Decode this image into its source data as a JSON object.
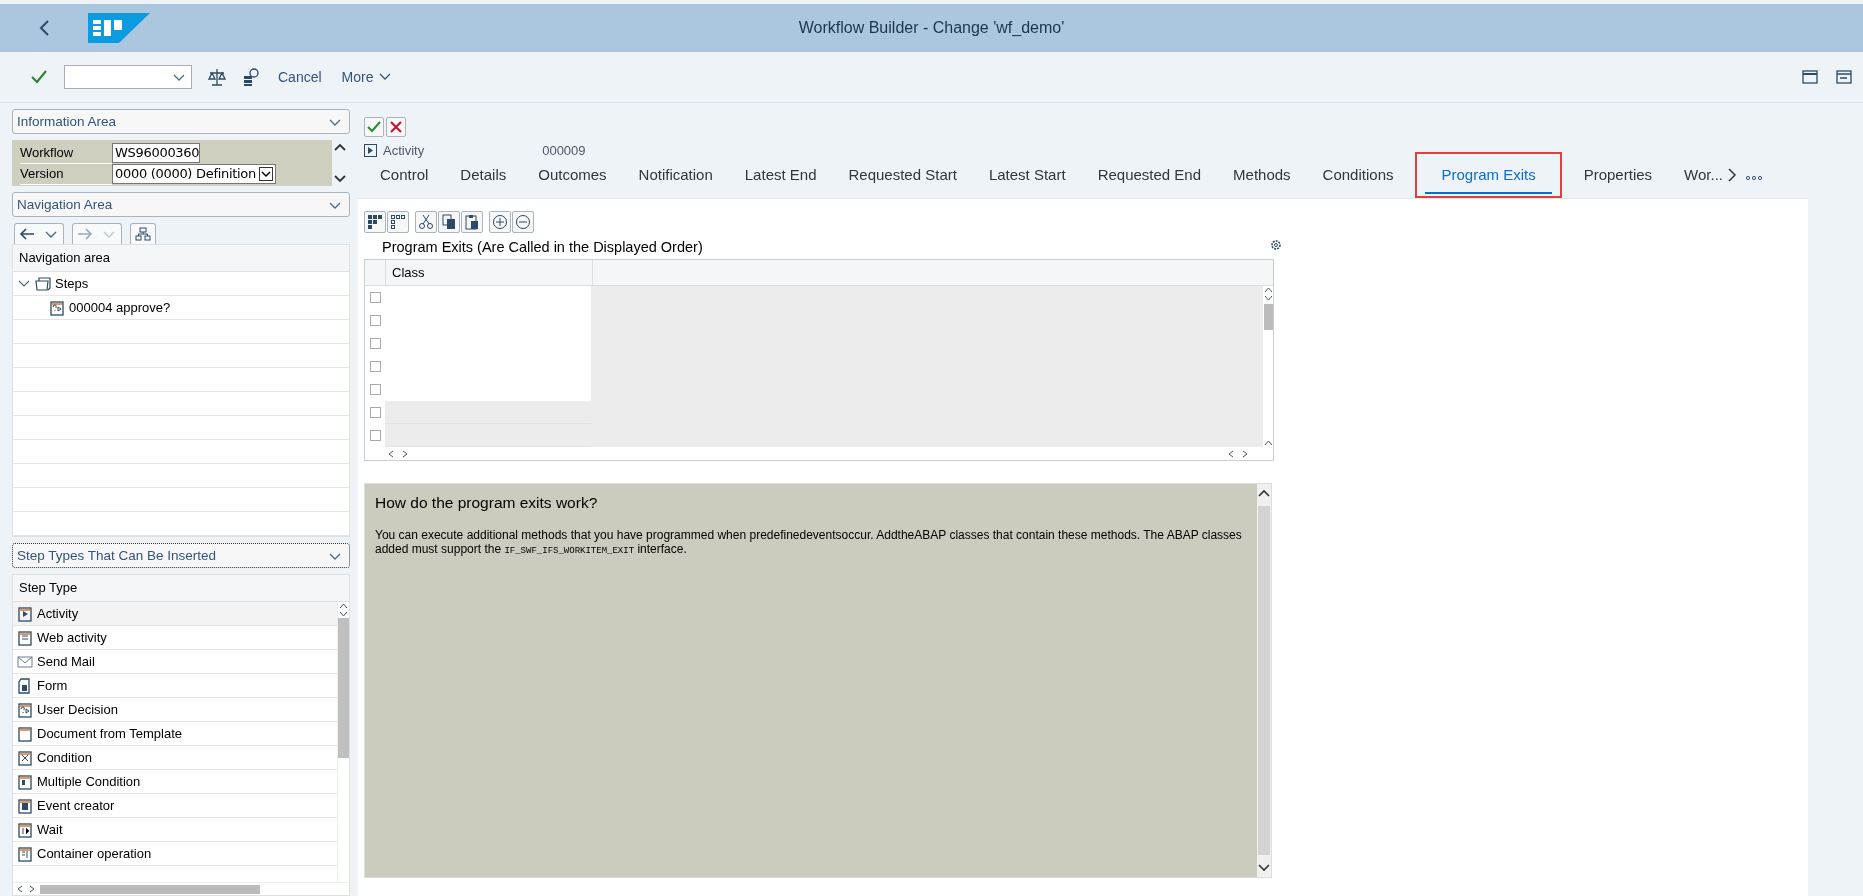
{
  "shell": {
    "title": "Workflow Builder - Change 'wf_demo'"
  },
  "toolbar": {
    "buttons": [
      "Cancel",
      "More"
    ]
  },
  "information_area": {
    "title": "Information Area",
    "fields": [
      {
        "label": "Workflow",
        "value": "WS96000360",
        "kind": "text"
      },
      {
        "label": "Version",
        "value": "0000 (0000) Definition",
        "kind": "dropdown"
      }
    ]
  },
  "navigation_area": {
    "title": "Navigation Area",
    "column": "Navigation area",
    "tree": [
      {
        "label": "Steps",
        "expanded": true,
        "children": [
          {
            "label": "000004 approve?"
          }
        ]
      }
    ]
  },
  "step_types": {
    "title": "Step Types That Can Be Inserted",
    "column": "Step Type",
    "items": [
      {
        "label": "Activity",
        "selected": true
      },
      {
        "label": "Web activity",
        "selected": false
      },
      {
        "label": "Send Mail",
        "selected": false
      },
      {
        "label": "Form",
        "selected": false
      },
      {
        "label": "User Decision",
        "selected": false
      },
      {
        "label": "Document from Template",
        "selected": false
      },
      {
        "label": "Condition",
        "selected": false
      },
      {
        "label": "Multiple Condition",
        "selected": false
      },
      {
        "label": "Event creator",
        "selected": false
      },
      {
        "label": "Wait",
        "selected": false
      },
      {
        "label": "Container operation",
        "selected": false
      }
    ]
  },
  "step": {
    "type": "Activity",
    "number": "000009"
  },
  "tabs": [
    {
      "label": "Control",
      "selected": false,
      "highlighted": false
    },
    {
      "label": "Details",
      "selected": false,
      "highlighted": false
    },
    {
      "label": "Outcomes",
      "selected": false,
      "highlighted": false
    },
    {
      "label": "Notification",
      "selected": false,
      "highlighted": false
    },
    {
      "label": "Latest End",
      "selected": false,
      "highlighted": false
    },
    {
      "label": "Requested Start",
      "selected": false,
      "highlighted": false
    },
    {
      "label": "Latest Start",
      "selected": false,
      "highlighted": false
    },
    {
      "label": "Requested End",
      "selected": false,
      "highlighted": false
    },
    {
      "label": "Methods",
      "selected": false,
      "highlighted": false
    },
    {
      "label": "Conditions",
      "selected": false,
      "highlighted": false
    },
    {
      "label": "Program Exits",
      "selected": true,
      "highlighted": true
    },
    {
      "label": "Properties",
      "selected": false,
      "highlighted": false
    },
    {
      "label": "Wor...",
      "selected": false,
      "highlighted": false
    }
  ],
  "program_exits": {
    "title": "Program Exits (Are Called in the Displayed Order)",
    "columns": [
      "Class"
    ],
    "rows": [
      {
        "checked": false,
        "editable": true
      },
      {
        "checked": false,
        "editable": true
      },
      {
        "checked": false,
        "editable": true
      },
      {
        "checked": false,
        "editable": true
      },
      {
        "checked": false,
        "editable": true
      },
      {
        "checked": false,
        "editable": false
      },
      {
        "checked": false,
        "editable": false
      }
    ]
  },
  "help": {
    "title": "How do the program exits work?",
    "text": [
      {
        "kind": "plain",
        "text": "You can execute additional methods that you have programmed when predefinedeventsoccur. AddtheABAP classes that contain these methods. The ABAP classes added must support the "
      },
      {
        "kind": "code",
        "text": "IF_SWF_IFS_WORKITEM_EXIT"
      },
      {
        "kind": "plain",
        "text": " interface."
      }
    ]
  }
}
